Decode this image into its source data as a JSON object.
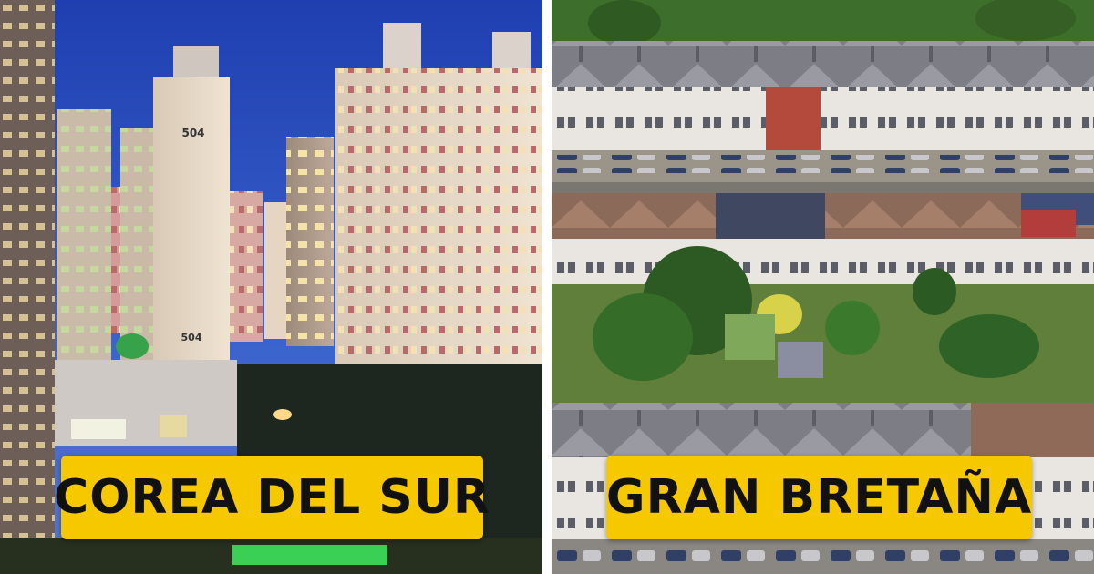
{
  "left_panel": {
    "caption": "COREA DEL SUR",
    "building_number_upper": "504",
    "building_number_lower": "504",
    "caption_bg": "#f5c800",
    "sky_color": "#2f54c8"
  },
  "right_panel": {
    "caption": "GRAN BRETAÑA",
    "caption_bg": "#f5c800"
  }
}
